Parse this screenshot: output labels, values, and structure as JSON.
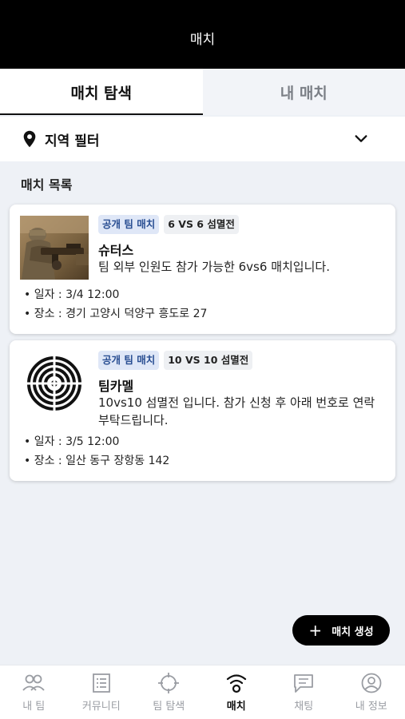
{
  "header": {
    "title": "매치"
  },
  "tabs": [
    {
      "label": "매치 탐색",
      "active": true
    },
    {
      "label": "내 매치",
      "active": false
    }
  ],
  "filter": {
    "label": "지역 필터",
    "icon": "map-pin-icon",
    "chevron": "chevron-down-icon"
  },
  "section": {
    "title": "매치 목록"
  },
  "matches": [
    {
      "type_badge": "공개 팀 매치",
      "format_badge": "6 VS 6 섬멸전",
      "team": "슈터스",
      "description": "팀 외부 인원도 참가 가능한 6vs6 매치입니다.",
      "date": "• 일자 : 3/4 12:00",
      "location": "• 장소 : 경기 고양시 덕양구 흥도로 27",
      "image": "soldier-photo"
    },
    {
      "type_badge": "공개 팀 매치",
      "format_badge": "10 VS 10 섬멸전",
      "team": "팀카멜",
      "description": "10vs10 섬멸전 입니다. 참가 신청 후 아래 번호로 연락 부탁드립니다.",
      "date": "• 일자 : 3/5 12:00",
      "location": "• 장소 : 일산 동구 장항동 142",
      "image": "target-logo"
    }
  ],
  "fab": {
    "icon": "+",
    "label": "매치 생성"
  },
  "bottom_nav": [
    {
      "label": "내 팀",
      "icon": "people-icon",
      "active": false
    },
    {
      "label": "커뮤니티",
      "icon": "list-icon",
      "active": false
    },
    {
      "label": "팀 탐색",
      "icon": "crosshair-icon",
      "active": false
    },
    {
      "label": "매치",
      "icon": "signal-icon",
      "active": true
    },
    {
      "label": "채팅",
      "icon": "chat-icon",
      "active": false
    },
    {
      "label": "내 정보",
      "icon": "user-icon",
      "active": false
    }
  ],
  "colors": {
    "accent": "#000000",
    "badge_blue_bg": "#dfe7f7",
    "badge_blue_text": "#2a4f93",
    "background": "#eef1f6"
  }
}
